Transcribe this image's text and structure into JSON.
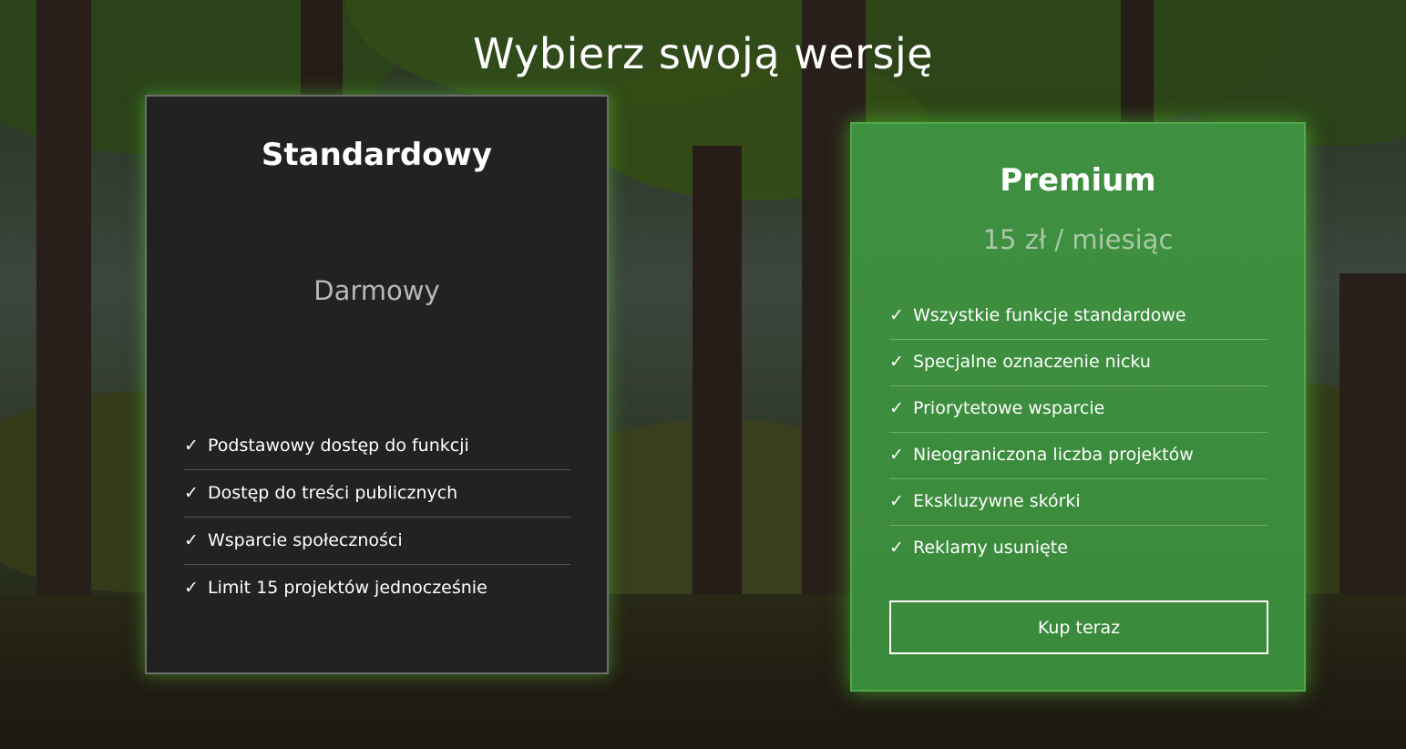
{
  "page": {
    "title": "Wybierz swoją wersję"
  },
  "plans": {
    "standard": {
      "name": "Standardowy",
      "price": "Darmowy",
      "check_icon": "✓",
      "features": [
        "Podstawowy dostęp do funkcji",
        "Dostęp do treści publicznych",
        "Wsparcie społeczności",
        "Limit 15 projektów jednocześnie"
      ]
    },
    "premium": {
      "name": "Premium",
      "price": "15 zł / miesiąc",
      "check_icon": "✓",
      "features": [
        "Wszystkie funkcje standardowe",
        "Specjalne oznaczenie nicku",
        "Priorytetowe wsparcie",
        "Nieograniczona liczba projektów",
        "Ekskluzywne skórki",
        "Reklamy usunięte"
      ],
      "button_label": "Kup teraz"
    }
  },
  "colors": {
    "standard_card_bg": "#222222",
    "premium_card_bg": "#3a8a3b",
    "glow": "#5ac83c"
  },
  "icons": {
    "check": "check-icon",
    "background": "forest-background"
  }
}
